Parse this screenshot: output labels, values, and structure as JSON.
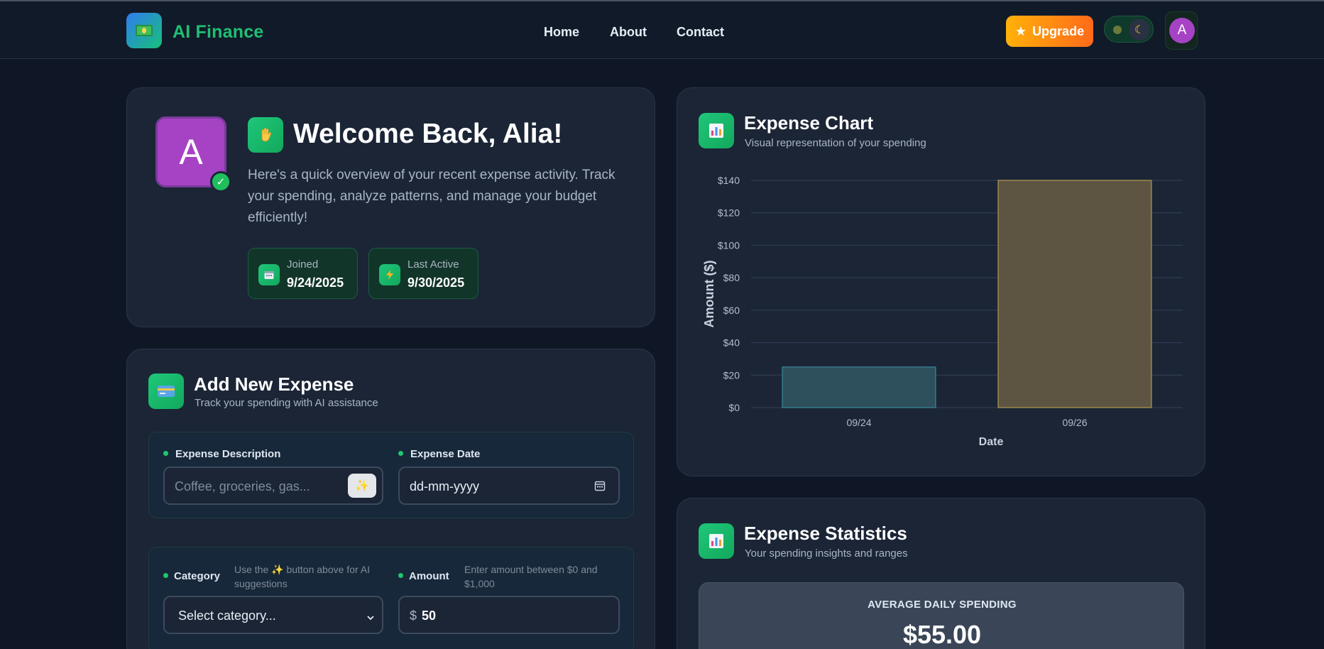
{
  "header": {
    "brand": "AI Finance",
    "nav": [
      "Home",
      "About",
      "Contact"
    ],
    "upgrade_label": "Upgrade",
    "avatar_initial": "A"
  },
  "welcome": {
    "avatar_initial": "A",
    "title": "Welcome Back, Alia!",
    "text": "Here's a quick overview of your recent expense activity. Track your spending, analyze patterns, and manage your budget efficiently!",
    "joined_label": "Joined",
    "joined_value": "9/24/2025",
    "last_active_label": "Last Active",
    "last_active_value": "9/30/2025"
  },
  "add_expense": {
    "title": "Add New Expense",
    "subtitle": "Track your spending with AI assistance",
    "description_label": "Expense Description",
    "description_placeholder": "Coffee, groceries, gas...",
    "date_label": "Expense Date",
    "date_placeholder": "dd-mm-yyyy",
    "category_label": "Category",
    "category_hint": "Use the ✨ button above for AI suggestions",
    "category_value": "Select category...",
    "amount_label": "Amount",
    "amount_hint": "Enter amount between $0 and $1,000",
    "amount_currency": "$",
    "amount_value": "50"
  },
  "expense_chart": {
    "title": "Expense Chart",
    "subtitle": "Visual representation of your spending"
  },
  "expense_stats": {
    "title": "Expense Statistics",
    "subtitle": "Your spending insights and ranges",
    "avg_label": "AVERAGE DAILY SPENDING",
    "avg_value": "$55.00"
  },
  "chart_data": {
    "type": "bar",
    "categories": [
      "09/24",
      "09/26"
    ],
    "values": [
      25,
      140
    ],
    "bar_colors": [
      "#2e4f5c",
      "#5e5442"
    ],
    "bar_borders": [
      "#3a8a9a",
      "#b39a50"
    ],
    "xlabel": "Date",
    "ylabel": "Amount ($)",
    "ylim": [
      0,
      140
    ],
    "yticks": [
      "$0",
      "$20",
      "$40",
      "$60",
      "$80",
      "$100",
      "$120",
      "$140"
    ],
    "grid": true
  },
  "colors": {
    "accent": "#1fbf74",
    "upgrade": "#ff8c12",
    "avatar": "#a642c4"
  }
}
